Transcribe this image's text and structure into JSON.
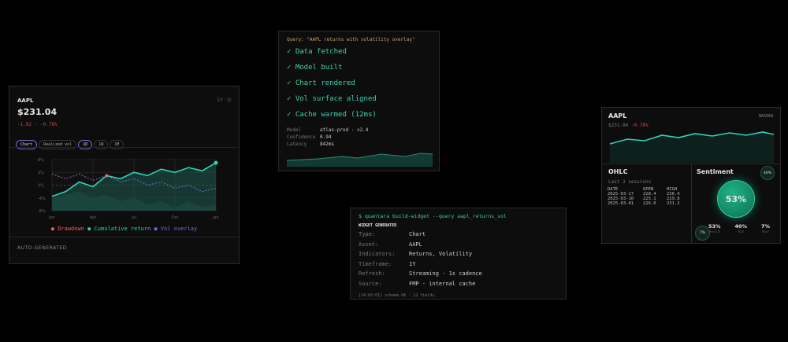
{
  "widget": {
    "ticker": "AAPL",
    "meta": "1Y · D",
    "price": "$231.04",
    "change": "-1.82 · -0.78%",
    "pills": [
      "Chart",
      "Realized vol",
      "1D",
      "1W",
      "1M"
    ],
    "footer": "AUTO-GENERATED"
  },
  "chart_data": {
    "type": "line",
    "x": [
      "Jan",
      "",
      "",
      "Apr",
      "",
      "",
      "Jul",
      "",
      "",
      "Oct",
      "",
      "",
      "Jan"
    ],
    "xticks": [
      "Jan",
      "Apr",
      "Jul",
      "Oct",
      "Jan"
    ],
    "yticks": [
      "8%",
      "4%",
      "0%",
      "-4%",
      "-8%"
    ],
    "ylim": [
      -8,
      8
    ],
    "series": [
      {
        "name": "Cumulative return",
        "color": "#2ed3b7",
        "values": [
          -3.5,
          -2,
          1,
          -0.5,
          3,
          2,
          4,
          3,
          5,
          4,
          5.5,
          4.5,
          7
        ]
      },
      {
        "name": "Vol overlay",
        "color": "#7b6ad6",
        "values": [
          3.5,
          2,
          3.5,
          1.5,
          3,
          1,
          2,
          0,
          1,
          -1,
          0,
          -2,
          -1
        ]
      },
      {
        "name": "Drawdown",
        "color": "#f06060",
        "values": [
          -4,
          -3,
          -2,
          -4,
          -3,
          -5,
          -4,
          -6,
          -5,
          -7,
          -5,
          -7,
          -6
        ]
      }
    ],
    "legend": [
      "Drawdown",
      "Cumulative return",
      "Vol overlay"
    ]
  },
  "status": {
    "query": "Query: \"AAPL returns with volatility overlay\"",
    "steps": [
      "✓ Data fetched",
      "✓ Model built",
      "✓ Chart rendered",
      "✓ Vol surface aligned",
      "✓ Cache warmed (12ms)"
    ],
    "meta": [
      {
        "k": "Model",
        "v": "atlas-prod · v2.4"
      },
      {
        "k": "Confidence",
        "v": "0.94"
      },
      {
        "k": "Latency",
        "v": "842ms"
      }
    ]
  },
  "quote": {
    "ticker": "AAPL",
    "exchange": "NASDAQ",
    "price": "$231.04",
    "change": "-0.78%",
    "ohlc_title": "OHLC",
    "ohlc_sub": "Last 3 sessions",
    "headers": [
      "DATE",
      "OPEN",
      "HIGH"
    ],
    "rows": [
      [
        "2025-03-17",
        "228.4",
        "236.4"
      ],
      [
        "2025-03-10",
        "225.1",
        "229.8"
      ],
      [
        "2025-03-01",
        "226.0",
        "231.2"
      ]
    ],
    "sentiment_title": "Sentiment",
    "big": "53%",
    "bubble_bull": "40%",
    "bubble_bear": "7%",
    "stats": [
      {
        "v": "53%",
        "l": "Neutral"
      },
      {
        "v": "40%",
        "l": "Bull"
      },
      {
        "v": "7%",
        "l": "Bear"
      }
    ]
  },
  "terminal": {
    "cmd": "$ quantara build-widget --query aapl_returns_vol",
    "heading": "WIDGET GENERATED",
    "fields": [
      {
        "k": "Type:",
        "v": "Chart"
      },
      {
        "k": "Asset:",
        "v": "AAPL"
      },
      {
        "k": "Indicators:",
        "v": "Returns, Volatility"
      },
      {
        "k": "Timeframe:",
        "v": "1Y"
      },
      {
        "k": "Refresh:",
        "v": "Streaming · 1s cadence"
      },
      {
        "k": "Source:",
        "v": "FMP · internal cache"
      }
    ],
    "log": "[14:02:01] schema OK · 12 fields"
  }
}
